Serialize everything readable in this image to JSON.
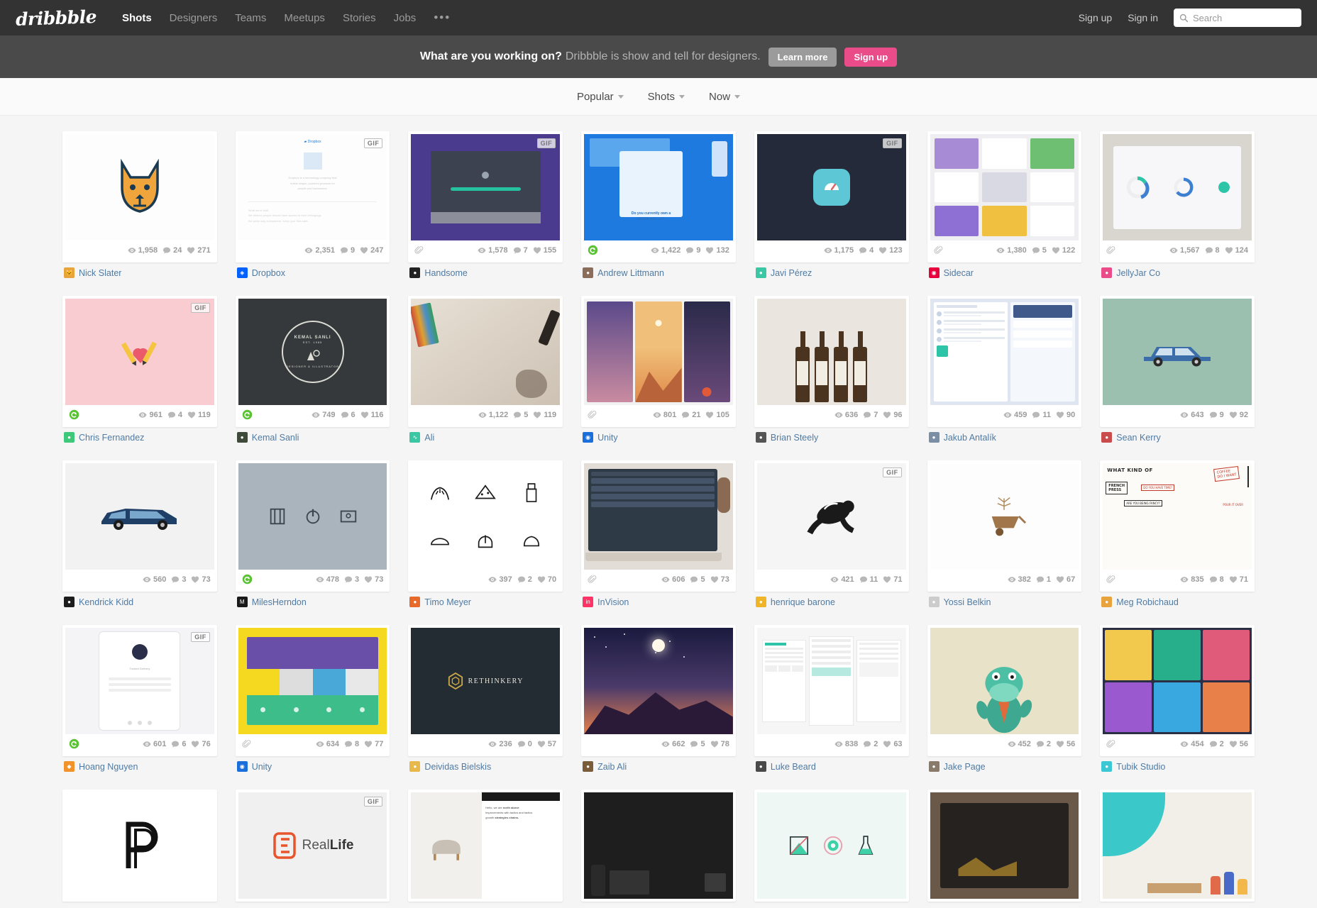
{
  "header": {
    "logo": "dribbble",
    "nav": [
      {
        "label": "Shots",
        "active": true
      },
      {
        "label": "Designers",
        "active": false
      },
      {
        "label": "Teams",
        "active": false
      },
      {
        "label": "Meetups",
        "active": false
      },
      {
        "label": "Stories",
        "active": false
      },
      {
        "label": "Jobs",
        "active": false
      }
    ],
    "more": "•••",
    "sign_up": "Sign up",
    "sign_in": "Sign in",
    "search_placeholder": "Search",
    "search_value": "",
    "search_icon": "search-icon",
    "bg_color": "#333333"
  },
  "banner": {
    "headline": "What are you working on?",
    "subline": "Dribbble is show and tell for designers.",
    "learn_more": "Learn more",
    "sign_up": "Sign up",
    "accent_color": "#ea4c89",
    "bg_color": "#4a4a4a"
  },
  "filters": [
    {
      "label": "Popular",
      "icon": "chevron-down-icon"
    },
    {
      "label": "Shots",
      "icon": "chevron-down-icon"
    },
    {
      "label": "Now",
      "icon": "chevron-down-icon"
    }
  ],
  "icons": {
    "views": "eye-icon",
    "comments": "comment-icon",
    "likes": "heart-icon",
    "attachment": "paperclip-icon",
    "rebound": "rebound-icon"
  },
  "shots": [
    {
      "author": "Nick Slater",
      "views": "1,958",
      "comments": "24",
      "likes": "271",
      "gif": false,
      "attachment": false,
      "rebound": false,
      "avatar_color": "#e8a33d",
      "avatar_glyph": "🐱",
      "thumb": "dog-illustration"
    },
    {
      "author": "Dropbox",
      "views": "2,351",
      "comments": "9",
      "likes": "247",
      "gif": true,
      "attachment": false,
      "rebound": false,
      "avatar_color": "#0061ff",
      "avatar_glyph": "◈",
      "thumb": "dropbox-webpage"
    },
    {
      "author": "Handsome",
      "views": "1,578",
      "comments": "7",
      "likes": "155",
      "gif": true,
      "attachment": true,
      "rebound": false,
      "avatar_color": "#222222",
      "avatar_glyph": "●",
      "thumb": "purple-app-screen"
    },
    {
      "author": "Andrew Littmann",
      "views": "1,422",
      "comments": "9",
      "likes": "132",
      "gif": false,
      "attachment": false,
      "rebound": true,
      "avatar_color": "#8a6d5b",
      "avatar_glyph": "●",
      "thumb": "blue-ui-dialog"
    },
    {
      "author": "Javi Pérez",
      "views": "1,175",
      "comments": "4",
      "likes": "123",
      "gif": true,
      "attachment": false,
      "rebound": false,
      "avatar_color": "#3cc7a4",
      "avatar_glyph": "●",
      "thumb": "dark-app-icon"
    },
    {
      "author": "Sidecar",
      "views": "1,380",
      "comments": "5",
      "likes": "122",
      "gif": false,
      "attachment": true,
      "rebound": false,
      "avatar_color": "#e8003c",
      "avatar_glyph": "◉",
      "thumb": "cards-collage"
    },
    {
      "author": "JellyJar Co",
      "views": "1,567",
      "comments": "8",
      "likes": "124",
      "gif": false,
      "attachment": true,
      "rebound": false,
      "avatar_color": "#ea4c89",
      "avatar_glyph": "●",
      "thumb": "tablet-dashboard"
    },
    {
      "author": "Chris Fernandez",
      "views": "961",
      "comments": "4",
      "likes": "119",
      "gif": true,
      "attachment": false,
      "rebound": true,
      "avatar_color": "#3ec97a",
      "avatar_glyph": "●",
      "thumb": "pink-pencil-heart"
    },
    {
      "author": "Kemal Sanli",
      "views": "749",
      "comments": "6",
      "likes": "116",
      "gif": false,
      "attachment": false,
      "rebound": true,
      "avatar_color": "#3f4a3a",
      "avatar_glyph": "●",
      "thumb": "dark-badge-logo"
    },
    {
      "author": "Ali",
      "views": "1,122",
      "comments": "5",
      "likes": "119",
      "gif": false,
      "attachment": false,
      "rebound": false,
      "avatar_color": "#3cc7a4",
      "avatar_glyph": "∿",
      "thumb": "pencil-drawing-photo"
    },
    {
      "author": "Unity",
      "views": "801",
      "comments": "21",
      "likes": "105",
      "gif": false,
      "attachment": true,
      "rebound": false,
      "avatar_color": "#1a6fdb",
      "avatar_glyph": "◉",
      "thumb": "mobile-landscape-trio"
    },
    {
      "author": "Brian Steely",
      "views": "636",
      "comments": "7",
      "likes": "96",
      "gif": false,
      "attachment": false,
      "rebound": false,
      "avatar_color": "#555555",
      "avatar_glyph": "●",
      "thumb": "beer-bottles-photo"
    },
    {
      "author": "Jakub Antalík",
      "views": "459",
      "comments": "11",
      "likes": "90",
      "gif": false,
      "attachment": false,
      "rebound": false,
      "avatar_color": "#7a8fa6",
      "avatar_glyph": "●",
      "thumb": "blue-dashboard-ui"
    },
    {
      "author": "Sean Kerry",
      "views": "643",
      "comments": "9",
      "likes": "92",
      "gif": false,
      "attachment": false,
      "rebound": false,
      "avatar_color": "#c94b4b",
      "avatar_glyph": "●",
      "thumb": "green-car-illustration"
    },
    {
      "author": "Kendrick Kidd",
      "views": "560",
      "comments": "3",
      "likes": "73",
      "gif": false,
      "attachment": false,
      "rebound": false,
      "avatar_color": "#1c1c1c",
      "avatar_glyph": "●",
      "thumb": "blue-wagon-car"
    },
    {
      "author": "MilesHerndon",
      "views": "478",
      "comments": "3",
      "likes": "73",
      "gif": false,
      "attachment": false,
      "rebound": true,
      "avatar_color": "#1a1a1a",
      "avatar_glyph": "M",
      "thumb": "gray-icon-set"
    },
    {
      "author": "Timo Meyer",
      "views": "397",
      "comments": "2",
      "likes": "70",
      "gif": false,
      "attachment": false,
      "rebound": false,
      "avatar_color": "#e86a2a",
      "avatar_glyph": "●",
      "thumb": "line-art-icons"
    },
    {
      "author": "InVision",
      "views": "606",
      "comments": "5",
      "likes": "73",
      "gif": false,
      "attachment": true,
      "rebound": false,
      "avatar_color": "#ff3366",
      "avatar_glyph": "in",
      "thumb": "laptop-desk-photo"
    },
    {
      "author": "henrique barone",
      "views": "421",
      "comments": "11",
      "likes": "71",
      "gif": true,
      "attachment": false,
      "rebound": false,
      "avatar_color": "#f0b429",
      "avatar_glyph": "●",
      "thumb": "black-figure-illustration"
    },
    {
      "author": "Yossi Belkin",
      "views": "382",
      "comments": "1",
      "likes": "67",
      "gif": false,
      "attachment": false,
      "rebound": false,
      "avatar_color": "#cccccc",
      "avatar_glyph": "●",
      "thumb": "wheelbarrow-plant"
    },
    {
      "author": "Meg Robichaud",
      "views": "835",
      "comments": "8",
      "likes": "71",
      "gif": false,
      "attachment": true,
      "rebound": false,
      "avatar_color": "#e8a33d",
      "avatar_glyph": "●",
      "thumb": "coffee-handwriting"
    },
    {
      "author": "Hoang Nguyen",
      "views": "601",
      "comments": "6",
      "likes": "76",
      "gif": true,
      "attachment": false,
      "rebound": true,
      "avatar_color": "#f0932b",
      "avatar_glyph": "◆",
      "thumb": "phone-dark-ui"
    },
    {
      "author": "Unity",
      "views": "634",
      "comments": "8",
      "likes": "77",
      "gif": false,
      "attachment": true,
      "rebound": false,
      "avatar_color": "#1a6fdb",
      "avatar_glyph": "◉",
      "thumb": "yellow-web-layout"
    },
    {
      "author": "Deividas Bielskis",
      "views": "236",
      "comments": "0",
      "likes": "57",
      "gif": false,
      "attachment": false,
      "rebound": false,
      "avatar_color": "#e8b84b",
      "avatar_glyph": "●",
      "thumb": "rethinkery-logo"
    },
    {
      "author": "Zaib Ali",
      "views": "662",
      "comments": "5",
      "likes": "78",
      "gif": false,
      "attachment": false,
      "rebound": false,
      "avatar_color": "#7a5c3a",
      "avatar_glyph": "●",
      "thumb": "night-mountain-moon"
    },
    {
      "author": "Luke Beard",
      "views": "838",
      "comments": "2",
      "likes": "63",
      "gif": false,
      "attachment": false,
      "rebound": false,
      "avatar_color": "#4a4a4a",
      "avatar_glyph": "●",
      "thumb": "mobile-wireframes"
    },
    {
      "author": "Jake Page",
      "views": "452",
      "comments": "2",
      "likes": "56",
      "gif": false,
      "attachment": false,
      "rebound": false,
      "avatar_color": "#8a7a6a",
      "avatar_glyph": "●",
      "thumb": "crocodile-character"
    },
    {
      "author": "Tubik Studio",
      "views": "454",
      "comments": "2",
      "likes": "56",
      "gif": false,
      "attachment": true,
      "rebound": false,
      "avatar_color": "#3cc7d4",
      "avatar_glyph": "●",
      "thumb": "colorful-grid-ui"
    }
  ],
  "shots_partial": [
    {
      "thumb": "black-p-monogram",
      "gif": false
    },
    {
      "thumb": "reallife-logo",
      "gif": true
    },
    {
      "thumb": "furniture-website",
      "gif": false
    },
    {
      "thumb": "dark-product-shot",
      "gif": false
    },
    {
      "thumb": "teal-icon-trio",
      "gif": false
    },
    {
      "thumb": "tshirt-photo",
      "gif": false
    },
    {
      "thumb": "workers-illustration",
      "gif": false
    }
  ]
}
